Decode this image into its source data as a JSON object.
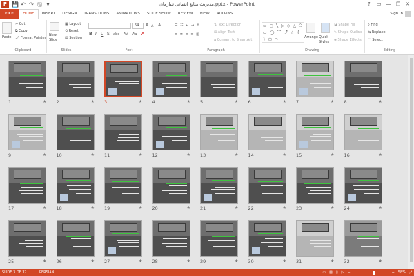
{
  "window": {
    "title": "مدیریت منابع انسانی سازمان.pptx - PowerPoint",
    "app_icon_letter": "P",
    "controls": [
      "?",
      "▭",
      "—",
      "❐",
      "✕"
    ]
  },
  "qat": [
    "💾",
    "↶",
    "↷",
    "🖫",
    "▾"
  ],
  "tabs": [
    "FILE",
    "HOME",
    "INSERT",
    "DESIGN",
    "TRANSITIONS",
    "ANIMATIONS",
    "SLIDE SHOW",
    "REVIEW",
    "VIEW",
    "ADD-INS"
  ],
  "active_tab": "HOME",
  "sign_in": "Sign in",
  "ribbon": {
    "clipboard": {
      "label": "Clipboard",
      "paste": "Paste",
      "cut": "Cut",
      "copy": "Copy",
      "format_painter": "Format Painter"
    },
    "slides": {
      "label": "Slides",
      "new_slide": "New Slide",
      "layout": "Layout",
      "reset": "Reset",
      "section": "Section"
    },
    "font": {
      "label": "Font",
      "font_name": "",
      "font_size": "54",
      "grow": "A",
      "shrink": "A",
      "clear": "A",
      "bold": "B",
      "italic": "I",
      "underline": "U",
      "shadow": "S",
      "strike": "abc",
      "spacing": "AV",
      "case": "Aa",
      "color": "A"
    },
    "paragraph": {
      "label": "Paragraph",
      "text_direction": "Text Direction",
      "align_text": "Align Text",
      "smartart": "Convert to SmartArt"
    },
    "drawing": {
      "label": "Drawing",
      "arrange": "Arrange",
      "quick_styles": "Quick Styles",
      "shape_fill": "Shape Fill",
      "shape_outline": "Shape Outline",
      "shape_effects": "Shape Effects"
    },
    "editing": {
      "label": "Editing",
      "find": "Find",
      "replace": "Replace",
      "select": "Select"
    }
  },
  "slides": [
    {
      "n": "1"
    },
    {
      "n": "2"
    },
    {
      "n": "3",
      "selected": true
    },
    {
      "n": "4"
    },
    {
      "n": "5"
    },
    {
      "n": "6"
    },
    {
      "n": "7"
    },
    {
      "n": "8"
    },
    {
      "n": "9"
    },
    {
      "n": "10"
    },
    {
      "n": "11"
    },
    {
      "n": "12"
    },
    {
      "n": "13"
    },
    {
      "n": "14"
    },
    {
      "n": "15"
    },
    {
      "n": "16"
    },
    {
      "n": "17"
    },
    {
      "n": "18"
    },
    {
      "n": "19"
    },
    {
      "n": "20"
    },
    {
      "n": "21"
    },
    {
      "n": "22"
    },
    {
      "n": "23"
    },
    {
      "n": "24"
    },
    {
      "n": "25"
    },
    {
      "n": "26"
    },
    {
      "n": "27"
    },
    {
      "n": "28"
    },
    {
      "n": "29"
    },
    {
      "n": "30"
    },
    {
      "n": "31"
    },
    {
      "n": "32"
    }
  ],
  "slide_star": "★",
  "status": {
    "slide_info": "SLIDE 3 OF 32",
    "language": "PERSIAN",
    "zoom": "58%",
    "zoom_level": 0.58
  },
  "colors": {
    "accent": "#d24726",
    "selected_border": "#d24726"
  }
}
